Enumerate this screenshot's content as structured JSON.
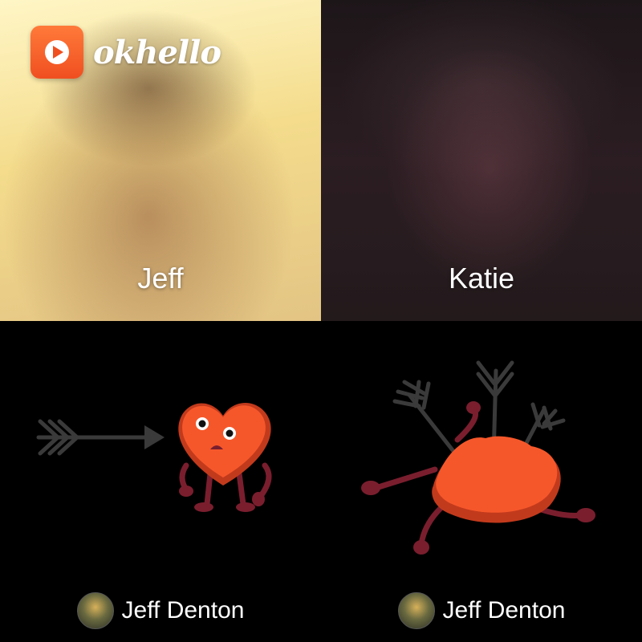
{
  "app": {
    "logo_text": "okhello",
    "brand_color": "#f4582a"
  },
  "tiles": [
    {
      "name": "Jeff"
    },
    {
      "name": "Katie"
    }
  ],
  "stickers": [
    {
      "sender": "Jeff Denton",
      "description_icon": "heart-arrow-incoming-icon"
    },
    {
      "sender": "Jeff Denton",
      "description_icon": "heart-hit-by-arrows-icon"
    }
  ],
  "colors": {
    "heart_top": "#f6572a",
    "heart_side": "#c23a1c",
    "limbs": "#7a1e2e",
    "arrow": "#3a3a3a"
  }
}
